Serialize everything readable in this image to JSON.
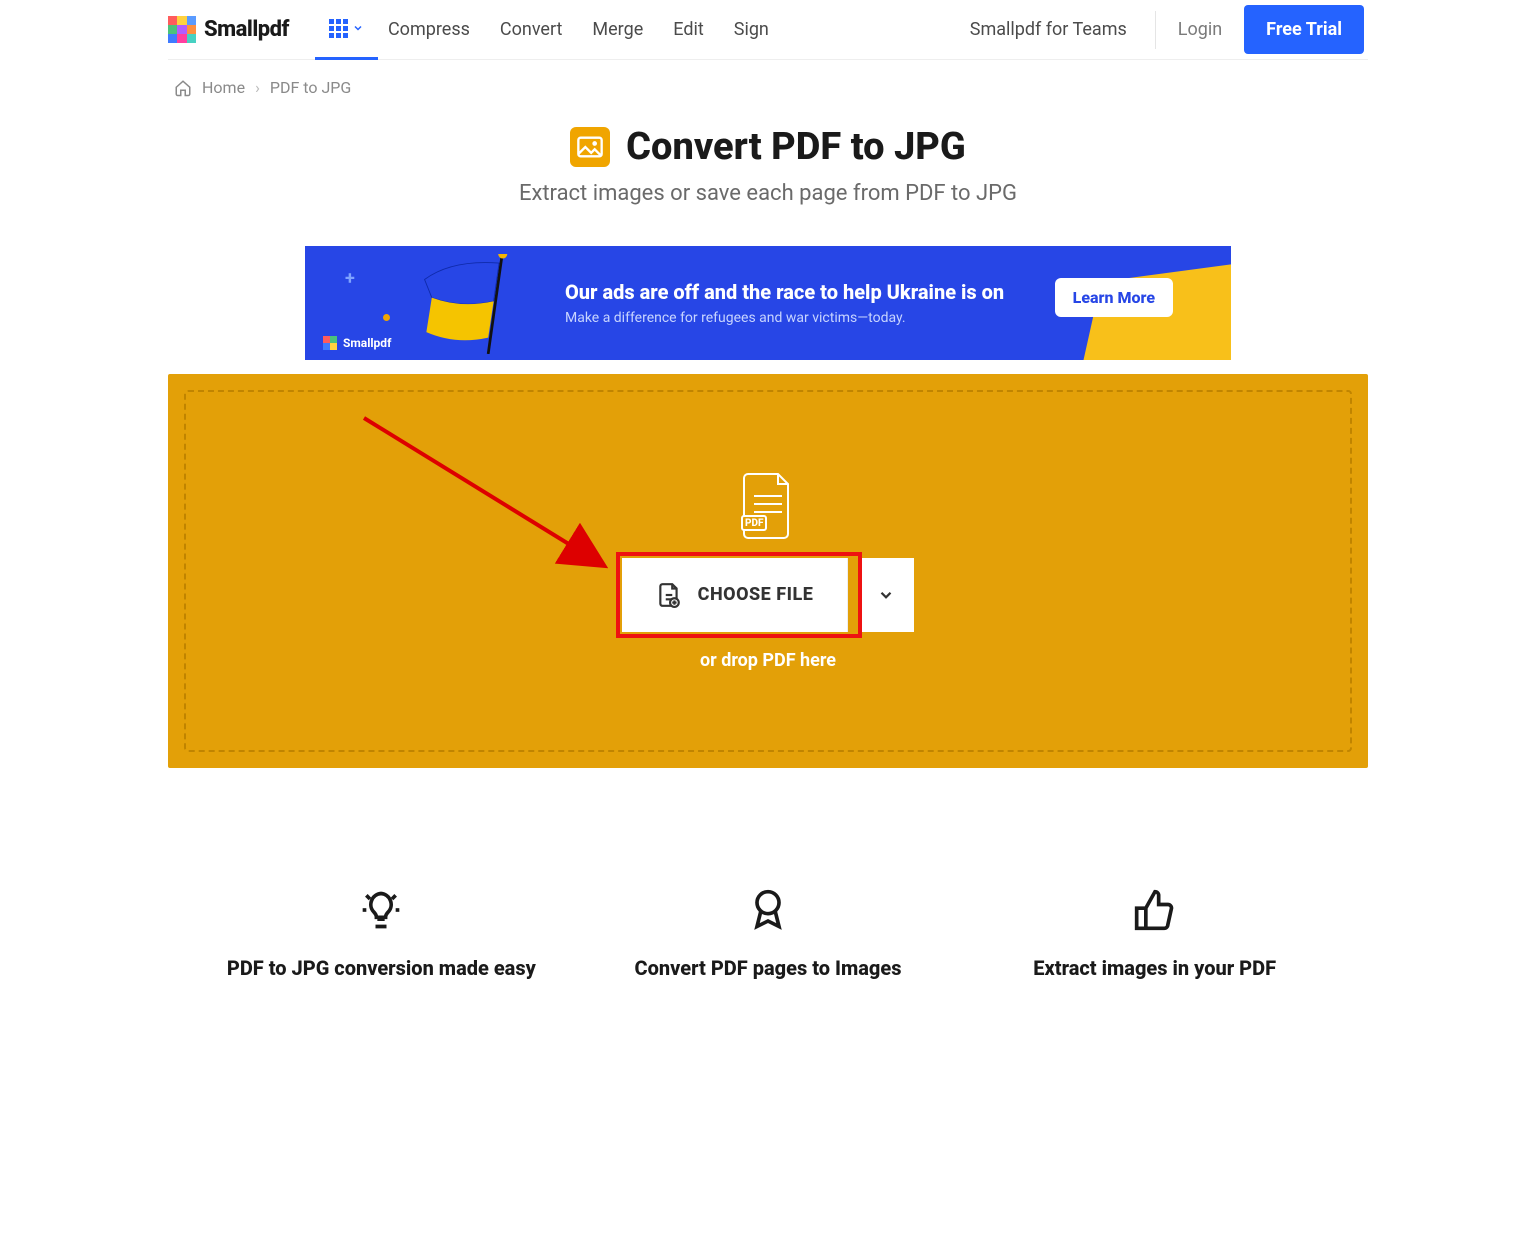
{
  "brand": "Smallpdf",
  "nav": {
    "compress": "Compress",
    "convert": "Convert",
    "merge": "Merge",
    "edit": "Edit",
    "sign": "Sign"
  },
  "header": {
    "teams": "Smallpdf for Teams",
    "login": "Login",
    "cta": "Free Trial"
  },
  "breadcrumb": {
    "home": "Home",
    "current": "PDF to JPG"
  },
  "title": "Convert PDF to JPG",
  "subtitle": "Extract images or save each page from PDF to JPG",
  "banner": {
    "headline": "Our ads are off and the race to help Ukraine is on",
    "sub": "Make a difference for refugees and war victims—today.",
    "cta": "Learn More",
    "minibrand": "Smallpdf"
  },
  "dropzone": {
    "choose": "CHOOSE FILE",
    "hint": "or drop PDF here",
    "badge": "PDF"
  },
  "features": {
    "a": "PDF to JPG conversion made easy",
    "b": "Convert PDF pages to Images",
    "c": "Extract images in your PDF"
  }
}
